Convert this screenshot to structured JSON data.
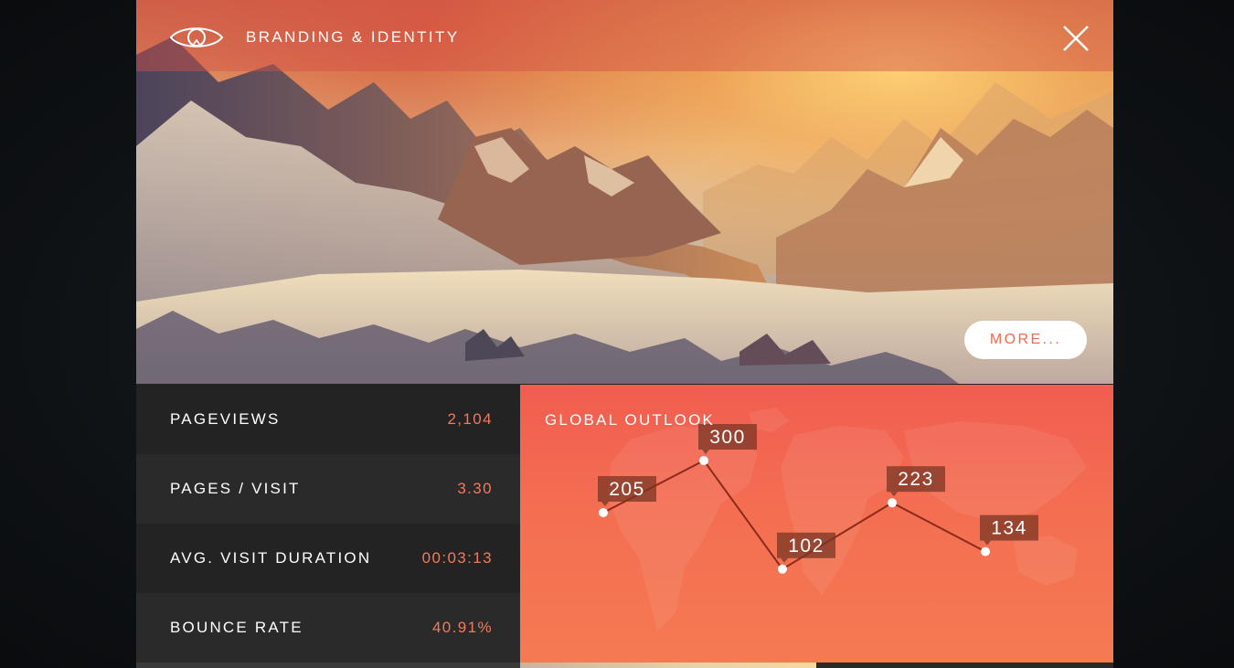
{
  "header": {
    "title": "BRANDING & IDENTITY",
    "brand_icon": "eye-icon",
    "close_icon": "close-icon"
  },
  "hero": {
    "image_subject": "mountain-landscape",
    "more_label": "MORE..."
  },
  "stats": [
    {
      "label": "PAGEVIEWS",
      "value": "2,104"
    },
    {
      "label": "PAGES / VISIT",
      "value": "3.30"
    },
    {
      "label": "AVG. VISIT DURATION",
      "value": "00:03:13"
    },
    {
      "label": "BOUNCE RATE",
      "value": "40.91%"
    }
  ],
  "colors": {
    "accent": "#f27a5b",
    "chart_bg": "#f46e52",
    "chart_line": "#8a2a1a",
    "label_bg": "#7a3524"
  },
  "chart_data": {
    "type": "line",
    "title": "GLOBAL OUTLOOK",
    "background": "world-map",
    "series": [
      {
        "values": [
          205,
          300,
          102,
          223,
          134
        ]
      }
    ],
    "data_labels": [
      "205",
      "300",
      "102",
      "223",
      "134"
    ],
    "grid": false
  }
}
